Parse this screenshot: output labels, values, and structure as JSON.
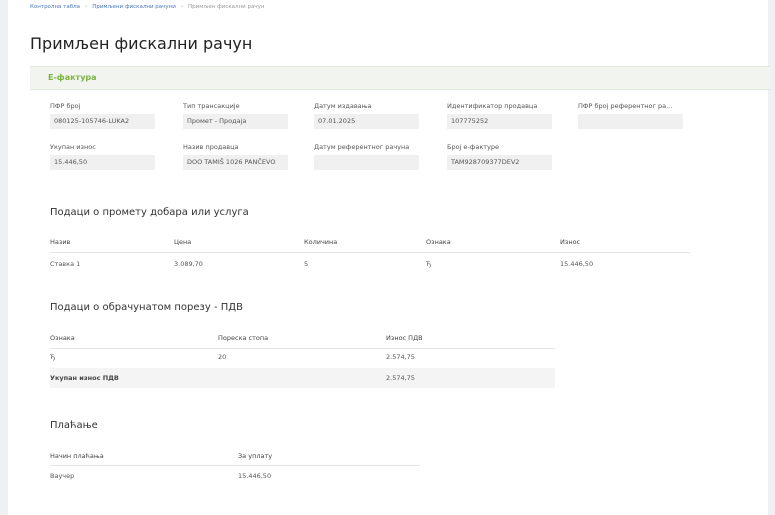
{
  "breadcrumb": {
    "items": [
      "Контролна табла",
      "Примљени фискални рачуни",
      "Примљен фискални рачун"
    ]
  },
  "page": {
    "title": "Примљен фискални рачун"
  },
  "section": {
    "title": "Е-фактура"
  },
  "fields": {
    "pfr": {
      "label": "ПФР број",
      "value": "080125-105746-LUKA2"
    },
    "type": {
      "label": "Тип трансакције",
      "value": "Промет - Продаја"
    },
    "date": {
      "label": "Датум издавања",
      "value": "07.01.2025"
    },
    "seller_id": {
      "label": "Идентификатор продавца",
      "value": "107775252"
    },
    "ref_pfr": {
      "label": "ПФР број референтног ра...",
      "value": ""
    },
    "total": {
      "label": "Укупан износ",
      "value": "15.446,50"
    },
    "seller_name": {
      "label": "Назив продавца",
      "value": "DOO TAMIŠ 1026 PANČEVO"
    },
    "ref_date": {
      "label": "Датум референтног рачуна",
      "value": ""
    },
    "einvoice": {
      "label": "Број е-фактуре",
      "value": "TAM928709377DEV2"
    }
  },
  "goods": {
    "title": "Подаци о промету добара или услуга",
    "headers": [
      "Назив",
      "Цена",
      "Количина",
      "Ознака",
      "Износ"
    ],
    "rows": [
      [
        "Ставка 1",
        "3.089,70",
        "5",
        "Ђ",
        "15.446,50"
      ]
    ]
  },
  "tax": {
    "title": "Подаци о обрачунатом порезу - ПДВ",
    "headers": [
      "Ознака",
      "Пореска стопа",
      "Износ ПДВ"
    ],
    "rows": [
      [
        "Ђ",
        "20",
        "2.574,75"
      ]
    ],
    "total_label": "Укупан износ ПДВ",
    "total_value": "2.574,75"
  },
  "payment": {
    "title": "Плаћање",
    "headers": [
      "Начин плаћања",
      "За уплату"
    ],
    "rows": [
      [
        "Ваучер",
        "15.446,50"
      ]
    ]
  }
}
